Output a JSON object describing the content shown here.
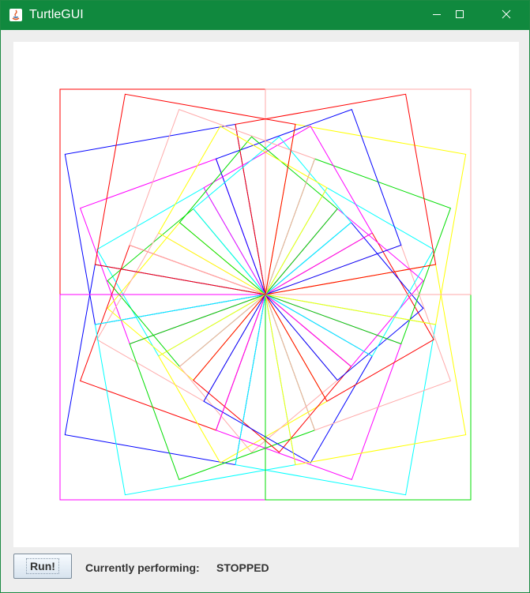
{
  "window": {
    "title": "TurtleGUI",
    "title_bar_color": "#10893e"
  },
  "title_bar_buttons": [
    "minimize-icon",
    "maximize-icon",
    "close-icon"
  ],
  "canvas": {
    "background": "#ffffff",
    "pattern": "rotating squares spiral",
    "square_count": 36,
    "rotation_step_degrees": 10,
    "colors": [
      "#ff0000",
      "#0000ff",
      "#ff00ff",
      "#00ffff",
      "#00dd00",
      "#ffff00",
      "#ffaaaa"
    ]
  },
  "controls": {
    "run_label": "Run!",
    "status_label": "Currently performing:",
    "status_value": "STOPPED"
  }
}
